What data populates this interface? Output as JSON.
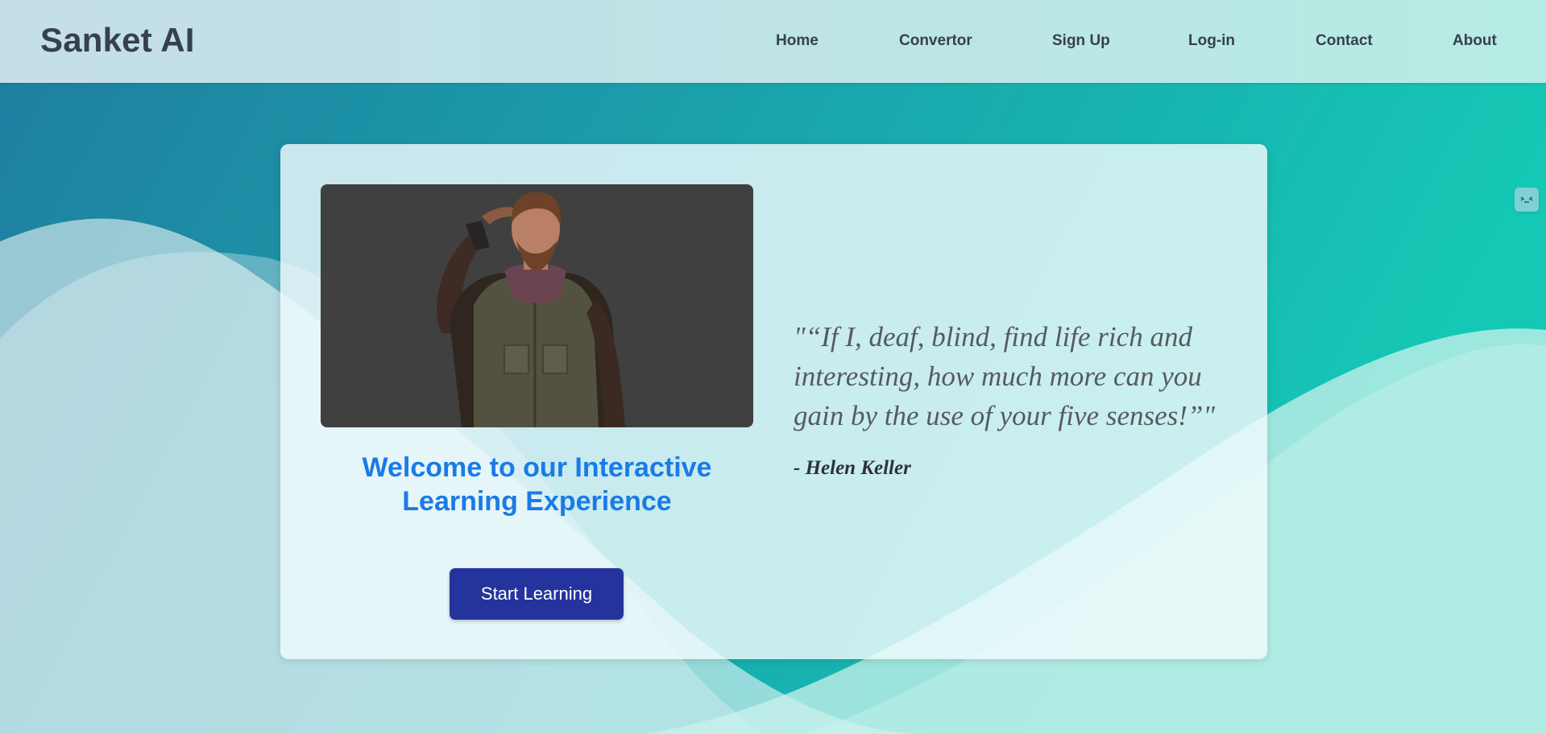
{
  "brand": "Sanket AI",
  "nav": {
    "items": [
      "Home",
      "Convertor",
      "Sign Up",
      "Log-in",
      "Contact",
      "About"
    ]
  },
  "hero": {
    "welcome_title": "Welcome to our Interactive Learning Experience",
    "start_button": "Start Learning",
    "quote": "\"“If I, deaf, blind, find life rich and interesting, how much more can you gain by the use of your five senses!”\"",
    "author": "- Helen Keller"
  },
  "side_widget": {
    "icon": "chat-bot-face-icon"
  },
  "colors": {
    "brand_text": "#37404f",
    "welcome_title": "#1a7be6",
    "start_button": "#25349c",
    "quote_text": "#555b60",
    "author_text": "#2e3236"
  }
}
